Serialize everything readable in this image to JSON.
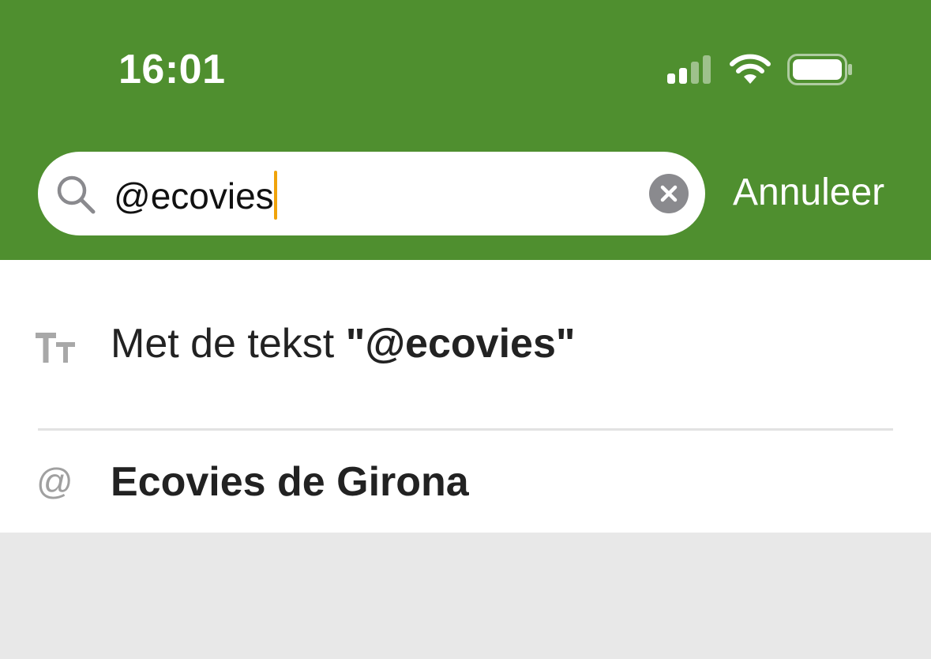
{
  "status_bar": {
    "time": "16:01",
    "signal_icon": "cellular-signal-icon",
    "wifi_icon": "wifi-icon",
    "battery_icon": "battery-icon"
  },
  "search": {
    "value": "@ecovies",
    "icon": "search-icon",
    "clear_icon": "clear-icon",
    "cancel_label": "Annuleer"
  },
  "results": [
    {
      "icon": "text-size-icon",
      "prefix": "Met de tekst ",
      "highlight": "\"@ecovies\""
    },
    {
      "icon": "at-icon",
      "icon_glyph": "@",
      "label": "Ecovies de Girona"
    }
  ],
  "colors": {
    "header": "#4f8f2f",
    "caret": "#f0a30a",
    "empty_area": "#e8e8e8"
  }
}
